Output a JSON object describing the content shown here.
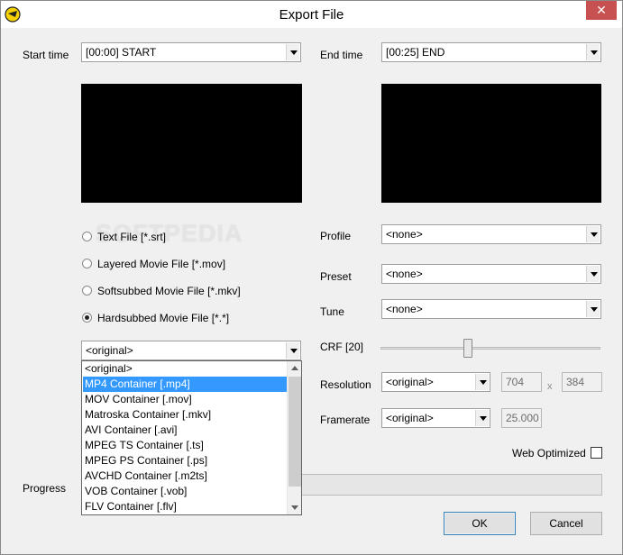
{
  "window": {
    "title": "Export File",
    "close_glyph": "✕"
  },
  "start": {
    "label": "Start time",
    "value": "[00:00] START"
  },
  "end": {
    "label": "End time",
    "value": "[00:25] END"
  },
  "watermark": "SOFTPEDIA",
  "output_types": [
    {
      "label": "Text File [*.srt]",
      "selected": false
    },
    {
      "label": "Layered Movie File [*.mov]",
      "selected": false
    },
    {
      "label": "Softsubbed Movie File [*.mkv]",
      "selected": false
    },
    {
      "label": "Hardsubbed Movie File [*.*]",
      "selected": true
    }
  ],
  "container": {
    "value": "<original>",
    "options": [
      "<original>",
      "MP4 Container [.mp4]",
      "MOV Container [.mov]",
      "Matroska Container [.mkv]",
      "AVI Container [.avi]",
      "MPEG TS Container [.ts]",
      "MPEG PS Container [.ps]",
      "AVCHD Container [.m2ts]",
      "VOB Container [.vob]",
      "FLV Container [.flv]"
    ],
    "highlighted_index": 1
  },
  "profile": {
    "label": "Profile",
    "value": "<none>"
  },
  "preset": {
    "label": "Preset",
    "value": "<none>"
  },
  "tune": {
    "label": "Tune",
    "value": "<none>"
  },
  "crf": {
    "label": "CRF [20]",
    "value": 20,
    "slider_fraction": 0.39
  },
  "resolution": {
    "label": "Resolution",
    "value": "<original>",
    "width": "704",
    "separator": "x",
    "height": "384"
  },
  "framerate": {
    "label": "Framerate",
    "value": "<original>",
    "fps": "25.000"
  },
  "web_optimized": {
    "label": "Web Optimized",
    "checked": false
  },
  "progress": {
    "label": "Progress"
  },
  "buttons": {
    "ok": "OK",
    "cancel": "Cancel"
  },
  "colors": {
    "highlight": "#3399ff",
    "preview": "#000000",
    "close": "#c75050"
  }
}
